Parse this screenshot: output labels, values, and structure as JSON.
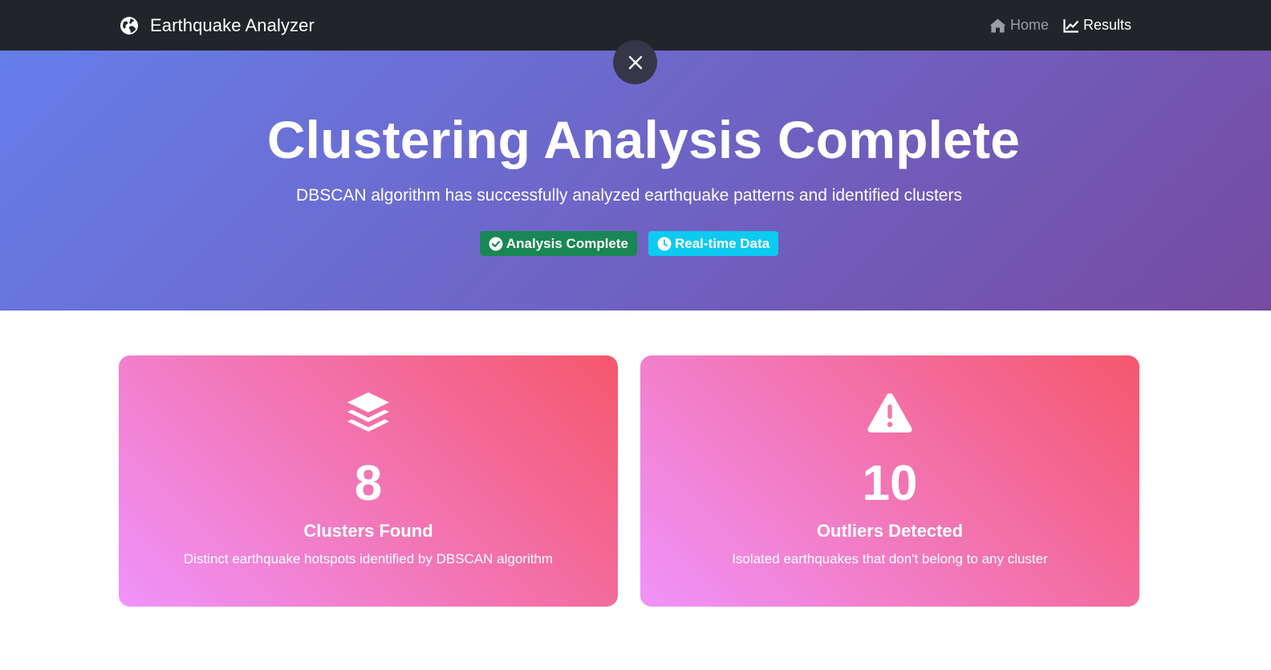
{
  "navbar": {
    "brand": "Earthquake Analyzer",
    "brand_icon": "globe-icon",
    "links": [
      {
        "label": "Home",
        "icon": "home-icon",
        "active": false
      },
      {
        "label": "Results",
        "icon": "chart-line-icon",
        "active": true
      }
    ]
  },
  "hero": {
    "close_icon": "close-icon",
    "title": "Clustering Analysis Complete",
    "subtitle": "DBSCAN algorithm has successfully analyzed earthquake patterns and identified clusters",
    "badges": [
      {
        "label": "Analysis Complete",
        "icon": "check-circle-icon",
        "color": "#198754"
      },
      {
        "label": "Real-time Data",
        "icon": "clock-icon",
        "color": "#0dcaf0"
      }
    ],
    "gradient": [
      "#667eea",
      "#764ba2"
    ]
  },
  "stats": [
    {
      "icon": "layers-icon",
      "value": "8",
      "label": "Clusters Found",
      "description": "Distinct earthquake hotspots identified by DBSCAN algorithm"
    },
    {
      "icon": "warning-triangle-icon",
      "value": "10",
      "label": "Outliers Detected",
      "description": "Isolated earthquakes that don't belong to any cluster"
    }
  ],
  "colors": {
    "navbar_bg": "#212529",
    "card_gradient": [
      "#f093fb",
      "#f5576c"
    ]
  }
}
